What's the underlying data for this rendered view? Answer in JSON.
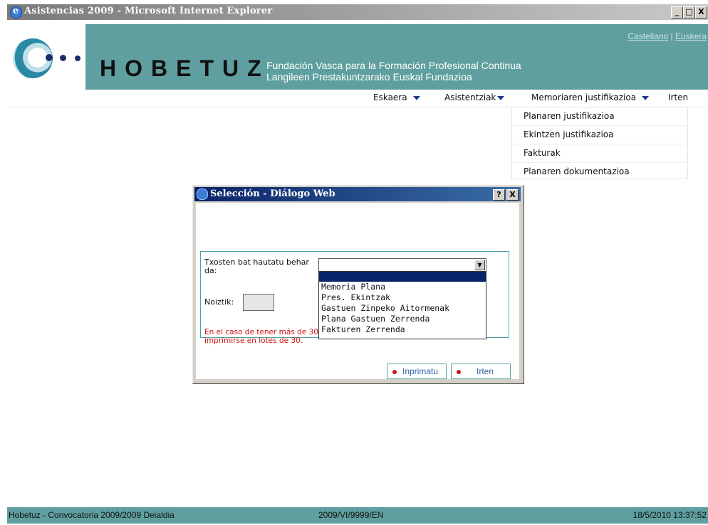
{
  "window": {
    "title": "Asistencias 2009 - Microsoft Internet Explorer",
    "controls": [
      "_",
      "□",
      "X"
    ]
  },
  "header": {
    "brand": "HOBETUZ",
    "subtitle_es": "Fundación Vasca para la Formación Profesional Continua",
    "subtitle_eu": "Langileen Prestakuntzarako Euskal Fundazioa",
    "lang_castellano": "Castellano",
    "lang_sep": "|",
    "lang_euskera": "Euskera"
  },
  "menu": {
    "eskaera": "Eskaera",
    "asistentziak": "Asistentziak",
    "memoriaren": "Memoriaren justifikazioa",
    "irten": "Irten"
  },
  "dropdown": {
    "items": [
      "Planaren justifikazioa",
      "Ekintzen justifikazioa",
      "Fakturak",
      "Planaren dokumentazioa"
    ]
  },
  "dialog": {
    "title": "Selección - Diálogo Web",
    "help": "?",
    "close": "X",
    "txosten_label": "Txosten bat hautatu behar da:",
    "select_value": "",
    "options": [
      "Memoria Plana",
      "Pres. Ekintzak",
      "Gastuen Zinpeko Aitormenak",
      "Plana Gastuen Zerrenda",
      "Fakturen Zerrenda"
    ],
    "noiztik_label": "Noiztik:",
    "noiztik_value": "",
    "warning_line1": "En el caso de tener más de 30",
    "warning_line2": "imprimirse en lotes de 30.",
    "print_button": "Inprimatu",
    "exit_button": "Irten"
  },
  "status": {
    "left": "Hobetuz - Convocatoria 2009/2009 Deialdia",
    "center": "2009/VI/9999/EN",
    "right": "18/5/2010 13:37:52"
  },
  "colors": {
    "teal": "#5f9f9f",
    "title_gradient": "#0a246a"
  }
}
